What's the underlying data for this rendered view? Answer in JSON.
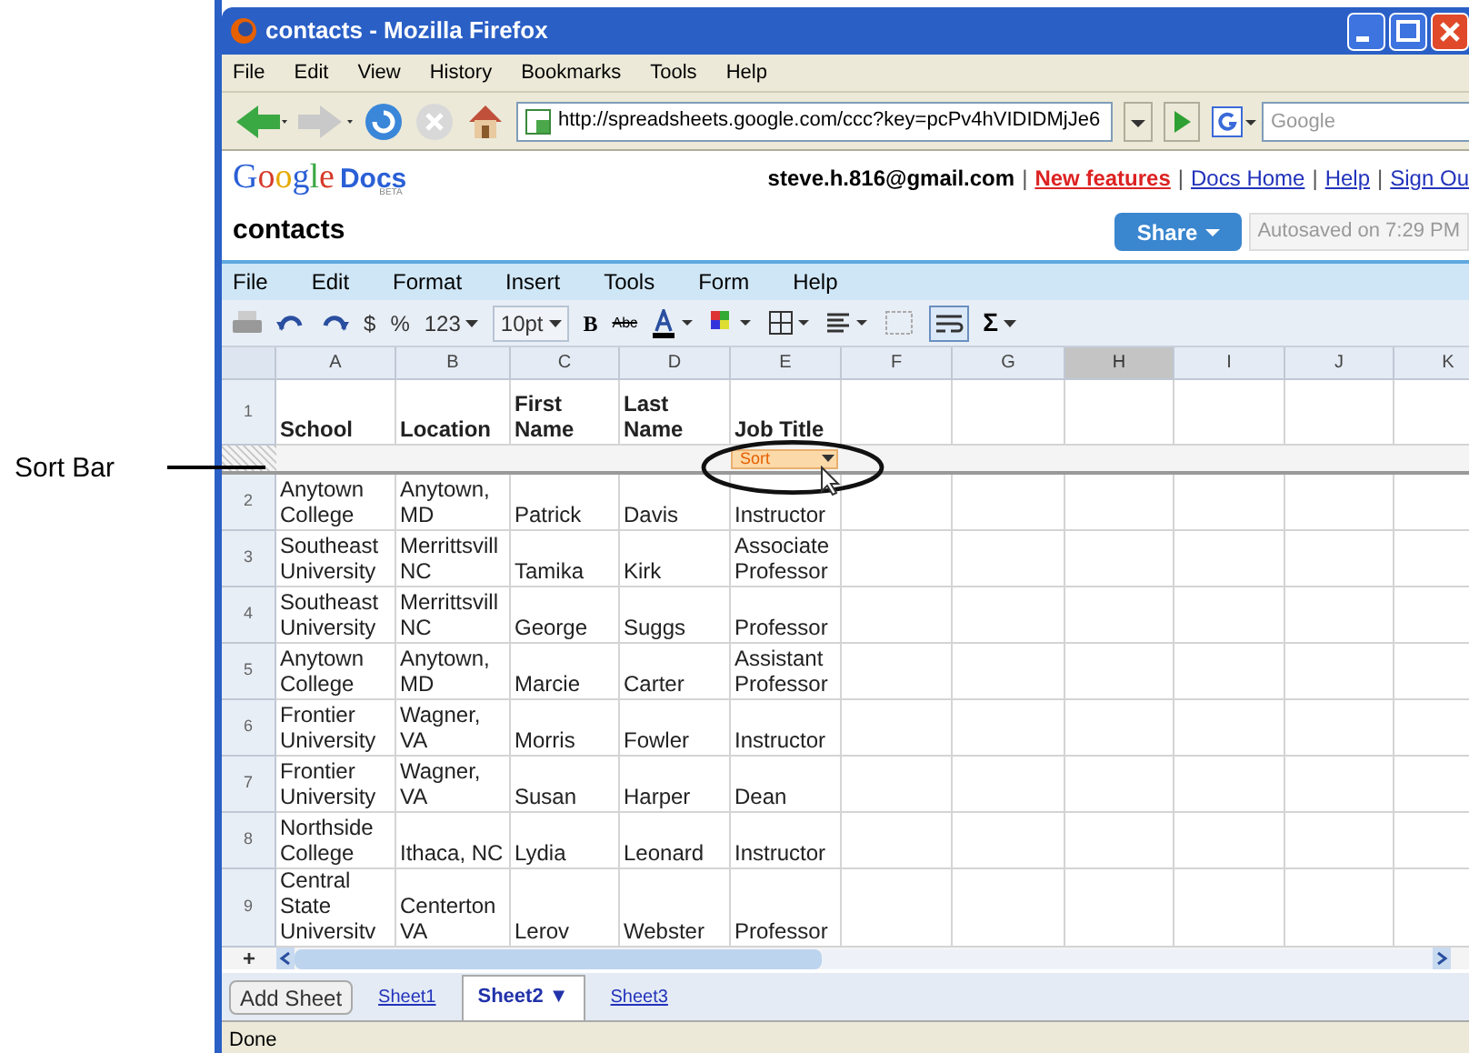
{
  "annotation": {
    "label": "Sort Bar"
  },
  "window": {
    "title": "contacts - Mozilla Firefox"
  },
  "browser_menu": [
    "File",
    "Edit",
    "View",
    "History",
    "Bookmarks",
    "Tools",
    "Help"
  ],
  "navigation": {
    "url": "http://spreadsheets.google.com/ccc?key=pcPv4hVIDIDMjJe6",
    "search_placeholder": "Google"
  },
  "docs_header": {
    "logo": {
      "name": "Google",
      "product": "Docs",
      "badge": "BETA"
    },
    "email": "steve.h.816@gmail.com",
    "separator": "|",
    "links": [
      {
        "text": "New features",
        "kind": "highlight"
      },
      {
        "text": "Docs Home",
        "kind": "link"
      },
      {
        "text": "Help",
        "kind": "link"
      },
      {
        "text": "Sign Ou",
        "kind": "link"
      }
    ]
  },
  "document": {
    "title": "contacts",
    "share_button": "Share",
    "autosave": "Autosaved on 7:29 PM"
  },
  "app_menu": [
    "File",
    "Edit",
    "Format",
    "Insert",
    "Tools",
    "Form",
    "Help"
  ],
  "toolbar": {
    "currency": "$",
    "percent": "%",
    "number_format": "123",
    "font_size": "10pt",
    "bold": "B",
    "strikethrough": "Abc",
    "sum": "Σ",
    "wrap_on": true
  },
  "columns": [
    {
      "label": "A",
      "selected": false
    },
    {
      "label": "B",
      "selected": false
    },
    {
      "label": "C",
      "selected": false
    },
    {
      "label": "D",
      "selected": false
    },
    {
      "label": "E",
      "selected": false
    },
    {
      "label": "F",
      "selected": false
    },
    {
      "label": "G",
      "selected": false
    },
    {
      "label": "H",
      "selected": true
    },
    {
      "label": "I",
      "selected": false
    },
    {
      "label": "J",
      "selected": false
    },
    {
      "label": "K",
      "selected": false
    }
  ],
  "header_row": {
    "number": "1",
    "cells": [
      "School",
      "Location",
      "First Name",
      "Last Name",
      "Job Title"
    ]
  },
  "sort_bar": {
    "label": "Sort"
  },
  "rows": [
    {
      "number": "2",
      "cells": [
        "Anytown College",
        "Anytown, MD",
        "Patrick",
        "Davis",
        "Instructor"
      ]
    },
    {
      "number": "3",
      "cells": [
        "Southeast University",
        "Merrittsvill NC",
        "Tamika",
        "Kirk",
        "Associate Professor"
      ]
    },
    {
      "number": "4",
      "cells": [
        "Southeast University",
        "Merrittsvill NC",
        "George",
        "Suggs",
        "Professor"
      ]
    },
    {
      "number": "5",
      "cells": [
        "Anytown College",
        "Anytown, MD",
        "Marcie",
        "Carter",
        "Assistant Professor"
      ]
    },
    {
      "number": "6",
      "cells": [
        "Frontier University",
        "Wagner, VA",
        "Morris",
        "Fowler",
        "Instructor"
      ]
    },
    {
      "number": "7",
      "cells": [
        "Frontier University",
        "Wagner, VA",
        "Susan",
        "Harper",
        "Dean"
      ]
    },
    {
      "number": "8",
      "cells": [
        "Northside College",
        "Ithaca, NC",
        "Lydia",
        "Leonard",
        "Instructor"
      ]
    },
    {
      "number": "9",
      "cells": [
        "Central State Universitv",
        "Centerton VA",
        "Lerov",
        "Webster",
        "Professor"
      ]
    }
  ],
  "add_row": "+",
  "add_sheet_button": "Add Sheet",
  "sheets": [
    {
      "label": "Sheet1",
      "selected": false
    },
    {
      "label": "Sheet2 ▼",
      "selected": true
    },
    {
      "label": "Sheet3",
      "selected": false
    }
  ],
  "status_bar": "Done"
}
